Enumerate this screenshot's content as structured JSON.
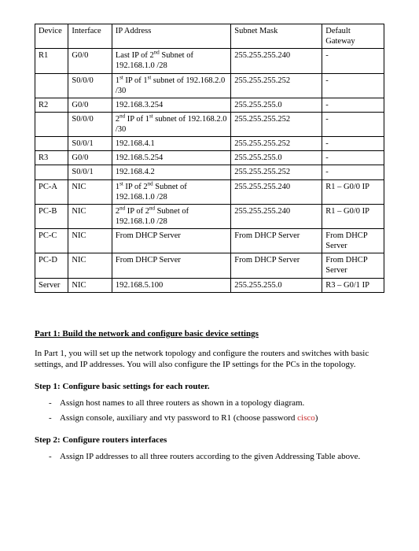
{
  "table": {
    "headers": {
      "device": "Device",
      "interface": "Interface",
      "ip": "IP Address",
      "mask": "Subnet Mask",
      "gw": "Default Gateway"
    },
    "rows": [
      {
        "device": "R1",
        "interface": "G0/0",
        "ip_html": "Last IP of 2<sup>nd</sup> Subnet of 192.168.1.0 /28",
        "mask": "255.255.255.240",
        "gw": "-"
      },
      {
        "device": "",
        "interface": "S0/0/0",
        "ip_html": "1<sup>st</sup> IP of 1<sup>st</sup> subnet of 192.168.2.0 /30",
        "mask": "255.255.255.252",
        "gw": "-"
      },
      {
        "device": "R2",
        "interface": "G0/0",
        "ip_html": "192.168.3.254",
        "mask": "255.255.255.0",
        "gw": "-"
      },
      {
        "device": "",
        "interface": "S0/0/0",
        "ip_html": "2<sup>nd</sup> IP of 1<sup>st</sup> subnet of 192.168.2.0 /30",
        "mask": "255.255.255.252",
        "gw": "-"
      },
      {
        "device": "",
        "interface": "S0/0/1",
        "ip_html": "192.168.4.1",
        "mask": "255.255.255.252",
        "gw": "-"
      },
      {
        "device": "R3",
        "interface": "G0/0",
        "ip_html": "192.168.5.254",
        "mask": "255.255.255.0",
        "gw": "-"
      },
      {
        "device": "",
        "interface": "S0/0/1",
        "ip_html": "192.168.4.2",
        "mask": "255.255.255.252",
        "gw": "-"
      },
      {
        "device": "PC-A",
        "interface": "NIC",
        "ip_html": "1<sup>st</sup> IP of 2<sup>nd</sup> Subnet of 192.168.1.0 /28",
        "mask": "255.255.255.240",
        "gw": "R1 – G0/0 IP"
      },
      {
        "device": "PC-B",
        "interface": "NIC",
        "ip_html": "2<sup>nd</sup> IP of 2<sup>nd</sup> Subnet of 192.168.1.0 /28",
        "mask": "255.255.255.240",
        "gw": "R1 – G0/0 IP"
      },
      {
        "device": "PC-C",
        "interface": "NIC",
        "ip_html": "From DHCP Server",
        "mask": "From DHCP Server",
        "gw": "From DHCP Server"
      },
      {
        "device": "PC-D",
        "interface": "NIC",
        "ip_html": "From DHCP Server",
        "mask": "From DHCP Server",
        "gw": "From DHCP Server"
      },
      {
        "device": "Server",
        "interface": "NIC",
        "ip_html": "192.168.5.100",
        "mask": "255.255.255.0",
        "gw": "R3 – G0/1 IP"
      }
    ]
  },
  "part1": {
    "title": "Part 1: Build the network and configure basic device settings",
    "intro": "In Part 1, you will set up the network topology and configure the routers and switches with basic settings, and IP addresses. You will also configure the IP settings for the PCs in the topology.",
    "step1_title": "Step 1:   Configure basic settings for each router.",
    "step1_items": [
      "Assign host names to all three routers as shown in a topology diagram.",
      "Assign console, auxiliary and vty password to R1 (choose password "
    ],
    "step1_pw_word": "cisco",
    "step1_pw_tail": ")",
    "step2_title": "Step 2: Configure routers interfaces",
    "step2_items": [
      "Assign IP addresses to all three routers according to the given Addressing Table above."
    ]
  }
}
